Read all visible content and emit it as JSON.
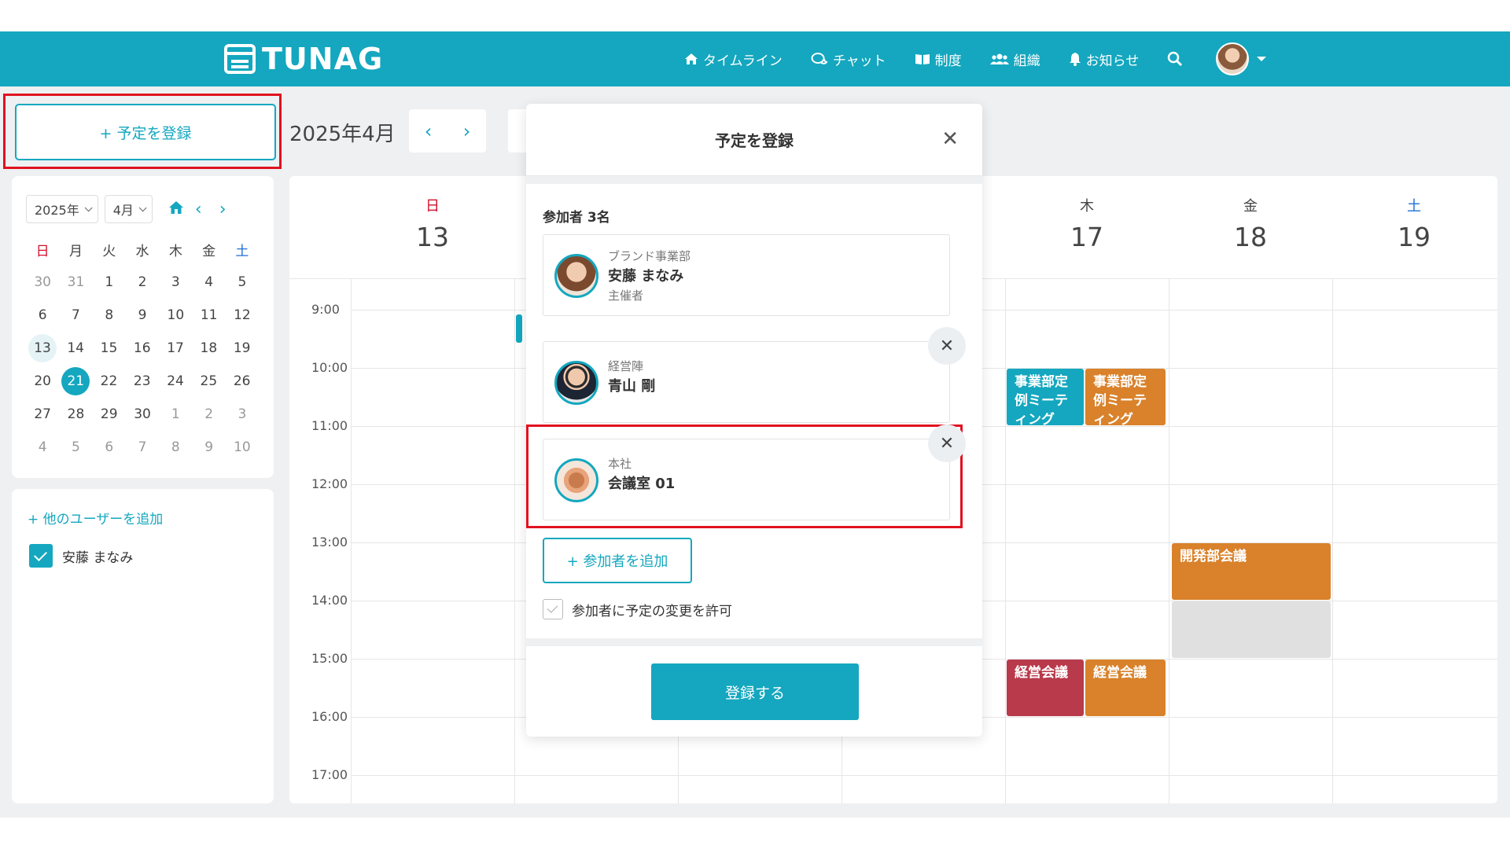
{
  "app": {
    "logo": "TUNAG"
  },
  "nav": {
    "items": [
      {
        "label": "タイムライン",
        "icon": "home-icon"
      },
      {
        "label": "チャット",
        "icon": "chat-icon"
      },
      {
        "label": "制度",
        "icon": "book-icon"
      },
      {
        "label": "組織",
        "icon": "people-icon"
      },
      {
        "label": "お知らせ",
        "icon": "bell-icon"
      }
    ]
  },
  "sidebar": {
    "add_event_label": "+ 予定を登録",
    "mini_calendar": {
      "year_select": "2025年",
      "month_select": "4月",
      "weekdays": [
        "日",
        "月",
        "火",
        "水",
        "木",
        "金",
        "土"
      ],
      "weeks": [
        [
          "30",
          "31",
          "1",
          "2",
          "3",
          "4",
          "5"
        ],
        [
          "6",
          "7",
          "8",
          "9",
          "10",
          "11",
          "12"
        ],
        [
          "13",
          "14",
          "15",
          "16",
          "17",
          "18",
          "19"
        ],
        [
          "20",
          "21",
          "22",
          "23",
          "24",
          "25",
          "26"
        ],
        [
          "27",
          "28",
          "29",
          "30",
          "1",
          "2",
          "3"
        ],
        [
          "4",
          "5",
          "6",
          "7",
          "8",
          "9",
          "10"
        ]
      ],
      "selected": "13",
      "today": "21"
    },
    "add_user_label": "+ 他のユーザーを追加",
    "users": [
      {
        "name": "安藤 まなみ",
        "checked": true
      }
    ]
  },
  "calendar": {
    "month_title": "2025年4月",
    "days": [
      {
        "dow": "日",
        "num": "13"
      },
      {
        "dow": "",
        "num": ""
      },
      {
        "dow": "",
        "num": ""
      },
      {
        "dow": "",
        "num": ""
      },
      {
        "dow": "木",
        "num": "17"
      },
      {
        "dow": "金",
        "num": "18"
      },
      {
        "dow": "土",
        "num": "19"
      }
    ],
    "times": [
      "9:00",
      "10:00",
      "11:00",
      "12:00",
      "13:00",
      "14:00",
      "15:00",
      "16:00",
      "17:00"
    ],
    "events": [
      {
        "title": "事業部定例ミーティング",
        "color": "#14a7bf"
      },
      {
        "title": "事業部定例ミーティング",
        "color": "#d9822b"
      },
      {
        "title": "開発部会議",
        "color": "#d9822b"
      },
      {
        "title": "",
        "color": "#e0e0e0"
      },
      {
        "title": "経営会議",
        "color": "#b83a4b"
      },
      {
        "title": "経営会議",
        "color": "#d9822b"
      }
    ]
  },
  "modal": {
    "title": "予定を登録",
    "participants_label": "参加者 3名",
    "participants": [
      {
        "org": "ブランド事業部",
        "name": "安藤 まなみ",
        "role": "主催者"
      },
      {
        "org": "経営陣",
        "name": "青山 剛",
        "role": ""
      },
      {
        "org": "本社",
        "name": "会議室 01",
        "role": ""
      }
    ],
    "add_participant_label": "+ 参加者を追加",
    "allow_change_label": "参加者に予定の変更を許可",
    "submit_label": "登録する"
  },
  "colors": {
    "accent": "#14a7bf",
    "highlight": "#e0121f",
    "sunday": "#d0102c",
    "saturday": "#1d6fd6"
  }
}
